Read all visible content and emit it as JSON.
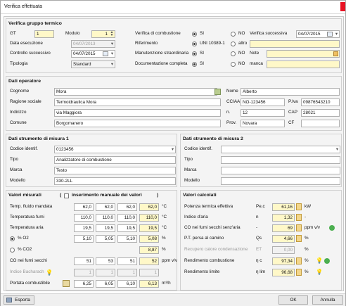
{
  "window": {
    "title": "Verifica effettuata"
  },
  "gruppo": {
    "title": "Verifica gruppo termico",
    "gt_label": "GT",
    "gt": "1",
    "modulo_label": "Modulo",
    "modulo": "1",
    "verifica_combustione_label": "Verifica di combustione",
    "si": "SI",
    "no": "NO",
    "verifica_successiva_label": "Verifica successiva",
    "verifica_successiva": "04/07/2015",
    "data_esecuzione_label": "Data esecuzione",
    "data_esecuzione": "04/07/2013",
    "riferimento_label": "Riferimento",
    "riferimento_uni": "UNI 10389-1",
    "riferimento_altro": "altro",
    "controllo_successivo_label": "Controllo successivo",
    "controllo_successivo": "04/07/2015",
    "manutenzione_label": "Manutenzione straordinaria",
    "note_label": "Note",
    "tipologia_label": "Tipologia",
    "tipologia": "Standard",
    "documentazione_label": "Documentazione completa",
    "manca_label": "manca"
  },
  "operatore": {
    "title": "Dati operatore",
    "cognome_label": "Cognome",
    "cognome": "Mora",
    "nome_label": "Nome",
    "nome": "Alberto",
    "ragione_label": "Ragione sociale",
    "ragione": "Termoidraulica Mora",
    "cciaa_label": "CCIAA",
    "cciaa": "NO-123456",
    "piva_label": "P.Iva",
    "piva": "09876543210",
    "indirizzo_label": "Indirizzo",
    "indirizzo": "via Maggiora",
    "n_label": "n.",
    "n": "12",
    "cap_label": "CAP",
    "cap": "28021",
    "comune_label": "Comune",
    "comune": "Borgomanero",
    "prov_label": "Prov.",
    "prov": "Novara",
    "cf_label": "CF",
    "cf": ""
  },
  "strumento1": {
    "title": "Dati strumento di misura 1",
    "codice_label": "Codice identif.",
    "codice": "0123456",
    "tipo_label": "Tipo",
    "tipo": "Analizzatore di combustione",
    "marca_label": "Marca",
    "marca": "Testo",
    "modello_label": "Modello",
    "modello": "330-2LL"
  },
  "strumento2": {
    "title": "Dati strumento di misura 2",
    "codice_label": "Codice identif.",
    "tipo_label": "Tipo",
    "marca_label": "Marca",
    "modello_label": "Modello"
  },
  "misurati": {
    "title": "Valori misurati",
    "manual_label": "inserimento manuale dei valori",
    "rows": [
      {
        "label": "Temp. fluido mandata",
        "v1": "62,0",
        "v2": "62,0",
        "v3": "62,0",
        "avg": "62,0",
        "unit": "°C"
      },
      {
        "label": "Temperatura fumi",
        "v1": "110,0",
        "v2": "110,0",
        "v3": "110,0",
        "avg": "110,0",
        "unit": "°C"
      },
      {
        "label": "Temperatura aria",
        "v1": "19,5",
        "v2": "19,5",
        "v3": "19,5",
        "avg": "19,5",
        "unit": "°C"
      },
      {
        "label": "% O2",
        "v1": "5,10",
        "v2": "5,05",
        "v3": "5,10",
        "avg": "5,08",
        "unit": "%"
      },
      {
        "label": "% CO2",
        "v1": "",
        "v2": "",
        "v3": "",
        "avg": "8,87",
        "unit": "%"
      },
      {
        "label": "CO nei fumi secchi",
        "v1": "51",
        "v2": "53",
        "v3": "51",
        "avg": "52",
        "unit": "ppm v/v"
      },
      {
        "label": "Indice Bacharach",
        "v1": "1",
        "v2": "1",
        "v3": "1",
        "avg": "1",
        "unit": ""
      },
      {
        "label": "Portata combustibile",
        "v1": "6,25",
        "v2": "6,05",
        "v3": "6,10",
        "avg": "6,13",
        "unit": "m³/h"
      }
    ]
  },
  "calcolati": {
    "title": "Valori calcolati",
    "rows": [
      {
        "label": "Potenza termica effettiva",
        "sym": "Pe,c",
        "val": "61,16",
        "unit": "kW"
      },
      {
        "label": "Indice d'aria",
        "sym": "n",
        "val": "1,32",
        "unit": "-"
      },
      {
        "label": "CO nei fumi secchi senz'aria",
        "sym": "-",
        "val": "69",
        "unit": "ppm v/v"
      },
      {
        "label": "P.T. persa al camino",
        "sym": "Qs",
        "val": "4,66",
        "unit": "%"
      },
      {
        "label": "Recupero calore condensazione",
        "sym": "ET",
        "val": "0,00",
        "unit": "%"
      },
      {
        "label": "Rendimento combustione",
        "sym": "η c",
        "val": "97,34",
        "unit": "%"
      },
      {
        "label": "Rendimento limite",
        "sym": "η lim",
        "val": "96,68",
        "unit": "%"
      }
    ]
  },
  "footer": {
    "esporta": "Esporta",
    "ok": "OK",
    "annulla": "Annulla"
  },
  "colors": {
    "highlight": "#fff8c8",
    "green": "#4caf50",
    "close": "#e81123"
  }
}
